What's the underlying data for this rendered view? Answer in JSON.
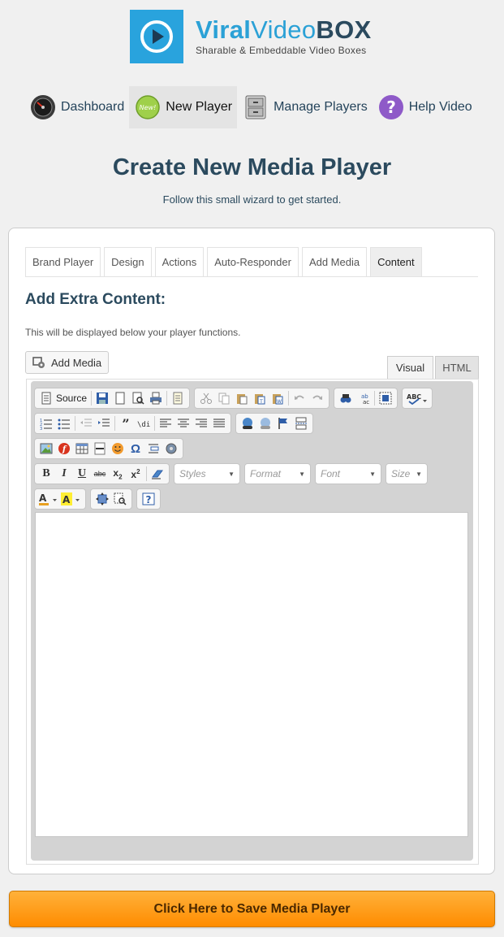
{
  "logo": {
    "title_part1": "Viral",
    "title_part2": "Video",
    "title_part3": "BOX",
    "tagline": "Sharable & Embeddable Video Boxes"
  },
  "nav": [
    {
      "label": "Dashboard",
      "icon": "speedometer-icon"
    },
    {
      "label": "New Player",
      "icon": "new-badge-icon",
      "active": true
    },
    {
      "label": "Manage Players",
      "icon": "cabinet-icon"
    },
    {
      "label": "Help Video",
      "icon": "question-icon"
    }
  ],
  "page": {
    "title": "Create New Media Player",
    "subtitle": "Follow this small wizard to get started."
  },
  "tabs": [
    "Brand Player",
    "Design",
    "Actions",
    "Auto-Responder",
    "Add Media",
    "Content"
  ],
  "active_tab": "Content",
  "section": {
    "title": "Add Extra Content:",
    "description": "This will be displayed below your player functions."
  },
  "editor": {
    "add_media_label": "Add Media",
    "mode_visual": "Visual",
    "mode_html": "HTML",
    "source_label": "Source",
    "combos": {
      "styles": "Styles",
      "format": "Format",
      "font": "Font",
      "size": "Size"
    }
  },
  "save_button": "Click Here to Save Media Player",
  "colors": {
    "accent": "#2ba1d6",
    "heading": "#2b4a5e",
    "save": "#ff9f1c"
  }
}
